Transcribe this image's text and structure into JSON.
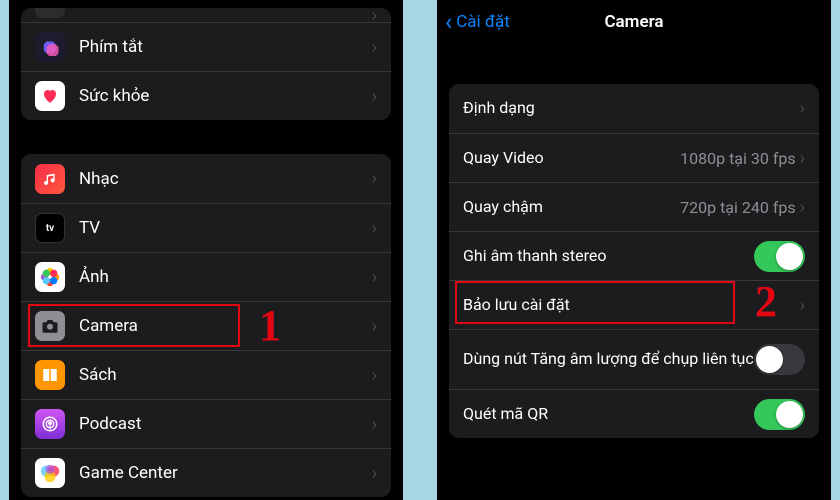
{
  "left": {
    "group1": [
      {
        "key": "shortcuts",
        "label": "Phím tắt"
      },
      {
        "key": "health",
        "label": "Sức khỏe"
      }
    ],
    "group2": [
      {
        "key": "music",
        "label": "Nhạc"
      },
      {
        "key": "tv",
        "label": "TV"
      },
      {
        "key": "photos",
        "label": "Ảnh"
      },
      {
        "key": "camera",
        "label": "Camera"
      },
      {
        "key": "books",
        "label": "Sách"
      },
      {
        "key": "podcast",
        "label": "Podcast"
      },
      {
        "key": "gamecenter",
        "label": "Game Center"
      }
    ]
  },
  "right": {
    "back": "Cài đặt",
    "title": "Camera",
    "rows": {
      "format": "Định dạng",
      "video": "Quay Video",
      "video_val": "1080p tại 30 fps",
      "slomo": "Quay chậm",
      "slomo_val": "720p tại 240 fps",
      "stereo": "Ghi âm thanh stereo",
      "preserve": "Bảo lưu cài đặt",
      "burst": "Dùng nút Tăng âm lượng để chụp liên tục",
      "qr": "Quét mã QR"
    }
  },
  "annotations": {
    "one": "1",
    "two": "2"
  }
}
